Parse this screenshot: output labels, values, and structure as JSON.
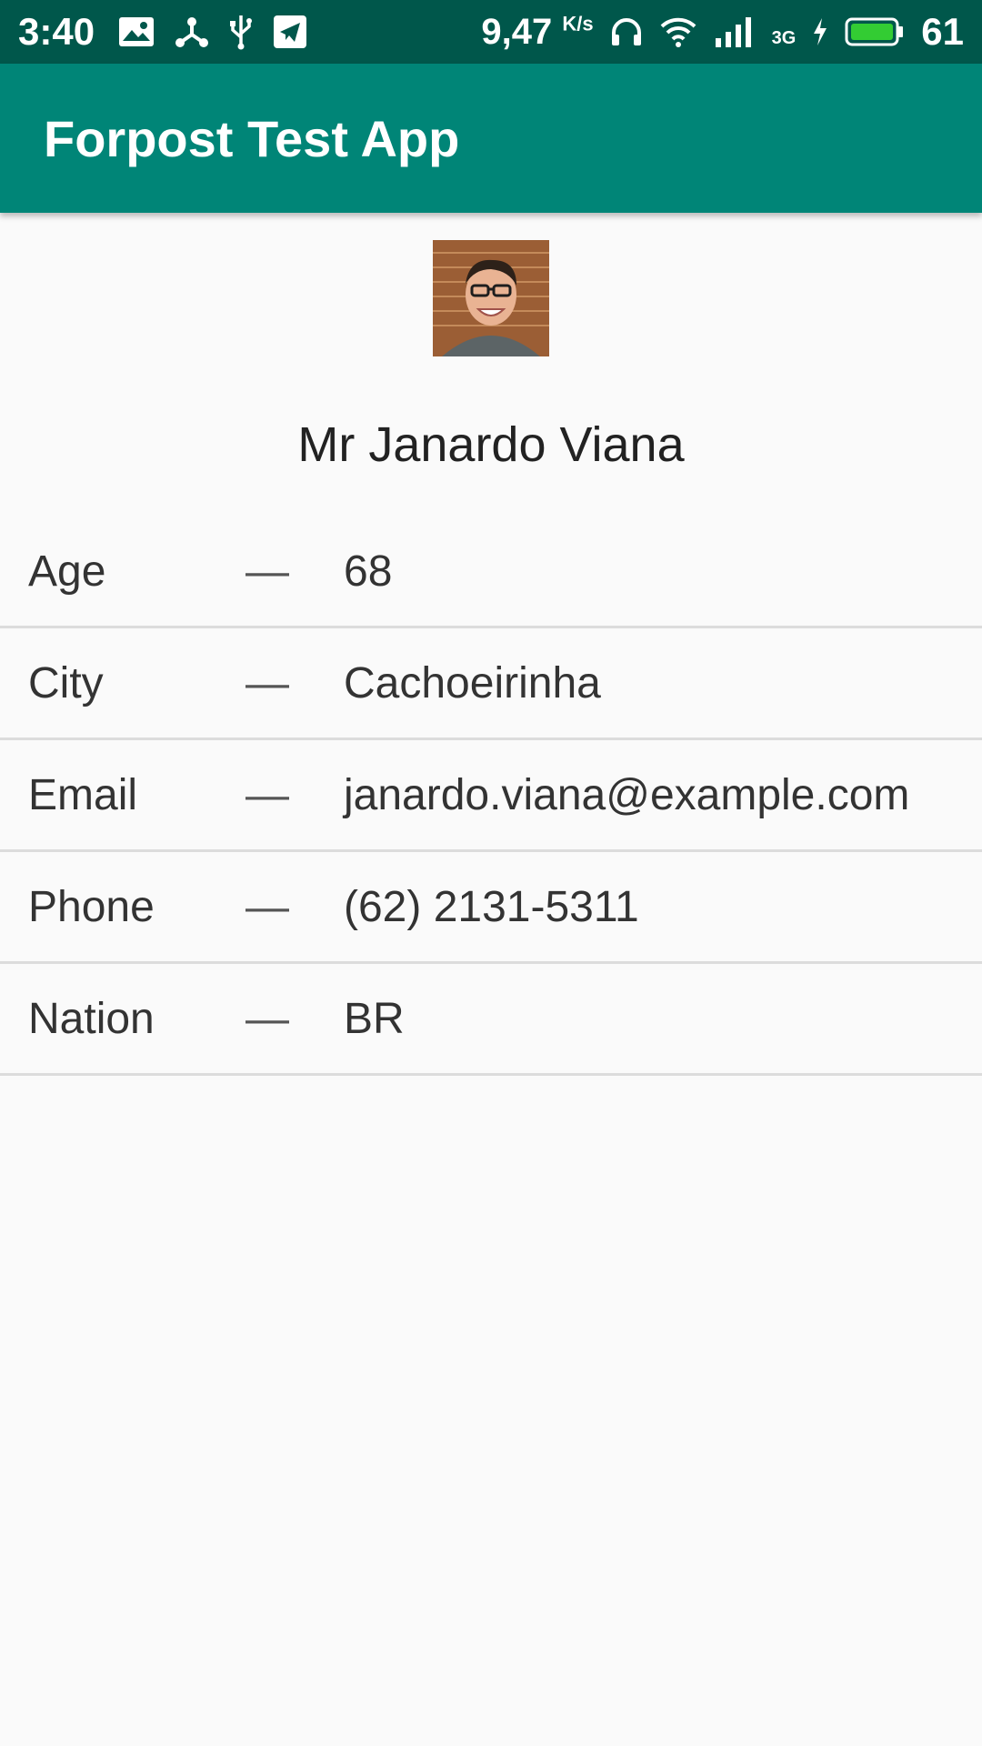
{
  "status_bar": {
    "time": "3:40",
    "net_speed": "9,47",
    "net_speed_unit": "K/s",
    "net_type": "3G",
    "battery_level": "61",
    "icons": [
      "gallery-notification-icon",
      "share-icon",
      "usb-icon",
      "telegram-icon",
      "headphones-icon",
      "wifi-icon",
      "signal-icon",
      "charging-icon",
      "battery-icon"
    ],
    "battery_color": "#33cc33"
  },
  "app_bar": {
    "title": "Forpost Test App",
    "color": "#008577"
  },
  "profile": {
    "full_name": "Mr Janardo Viana",
    "avatar_icon": "user-photo",
    "details": [
      {
        "label": "Age",
        "separator": "—",
        "value": "68"
      },
      {
        "label": "City",
        "separator": "—",
        "value": "Cachoeirinha"
      },
      {
        "label": "Email",
        "separator": "—",
        "value": "janardo.viana@example.com"
      },
      {
        "label": "Phone",
        "separator": "—",
        "value": "(62) 2131-5311"
      },
      {
        "label": "Nation",
        "separator": "—",
        "value": "BR"
      }
    ]
  }
}
